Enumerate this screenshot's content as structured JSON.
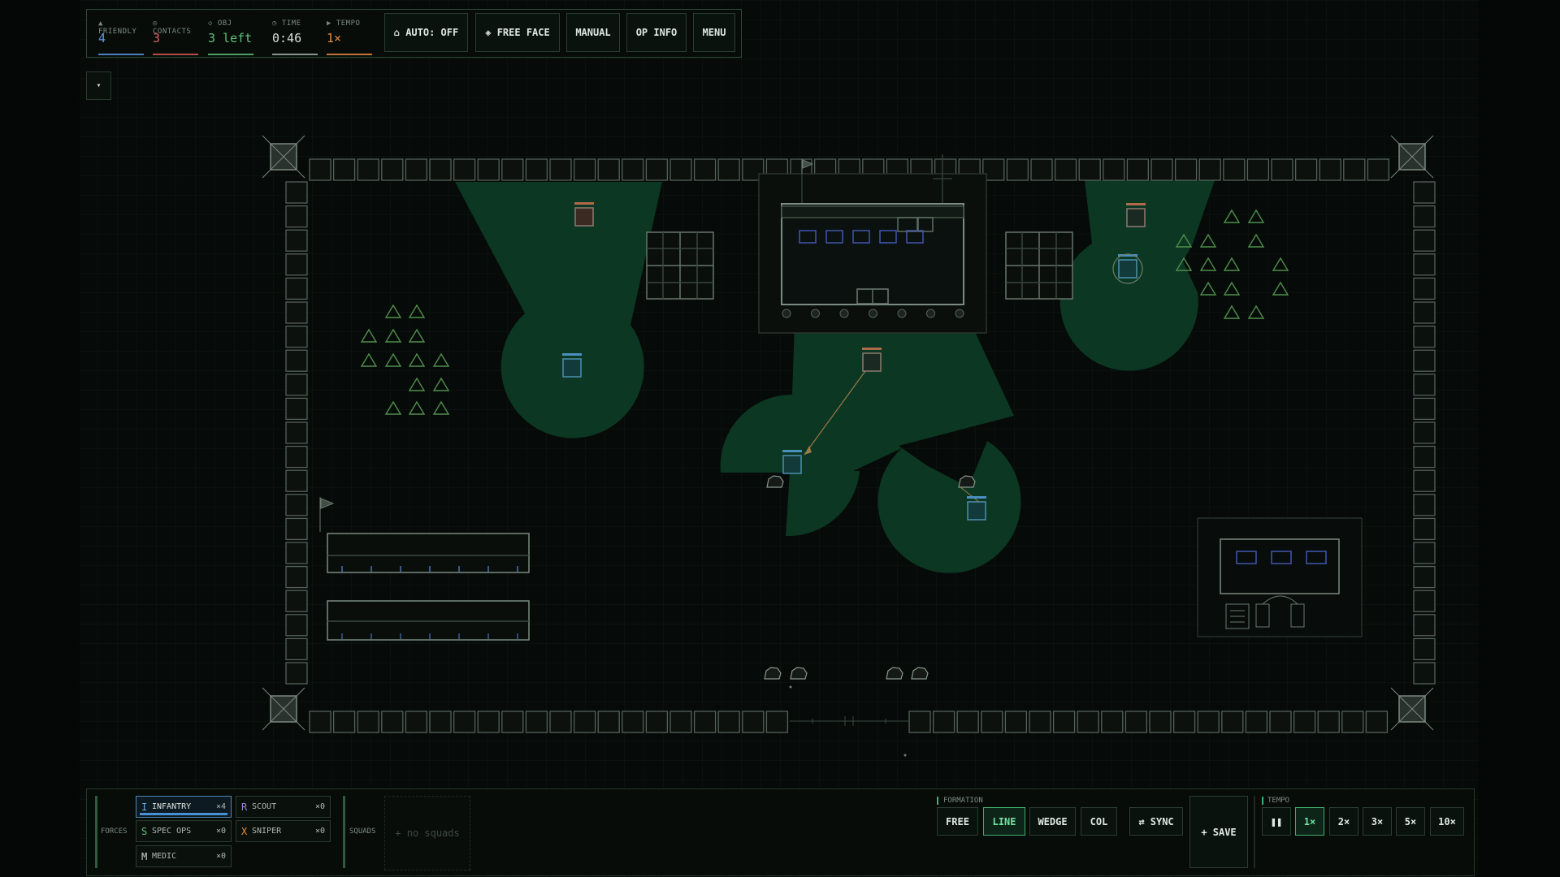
{
  "hud": {
    "stats": [
      {
        "label": "▲ FRIENDLY",
        "value": "4",
        "color": "#5a9be0"
      },
      {
        "label": "◎ CONTACTS",
        "value": "3",
        "color": "#d9605a"
      },
      {
        "label": "◇ OBJ",
        "value": "3 left",
        "color": "#5fc07d"
      },
      {
        "label": "◷ TIME",
        "value": "0:46",
        "color": "#d7dedb"
      },
      {
        "label": "▶ TEMPO",
        "value": "1×",
        "color": "#e38a3f"
      }
    ],
    "buttons": {
      "auto": "⌂ AUTO: OFF",
      "free_face": "◈ FREE FACE",
      "manual": "MANUAL",
      "op_info": "OP INFO",
      "menu": "MENU"
    }
  },
  "collapse_label": "▾",
  "bottom": {
    "forces_label": "FORCES",
    "units": [
      {
        "key": "I",
        "name": "INFANTRY",
        "count": "×4",
        "key_color": "#6aa6e6",
        "selected": true
      },
      {
        "key": "R",
        "name": "SCOUT",
        "count": "×0",
        "key_color": "#a07ee0"
      },
      {
        "key": "S",
        "name": "SPEC OPS",
        "count": "×0",
        "key_color": "#5fc07d"
      },
      {
        "key": "X",
        "name": "SNIPER",
        "count": "×0",
        "key_color": "#e38a3f"
      },
      {
        "key": "M",
        "name": "MEDIC",
        "count": "×0",
        "key_color": "#cfd6d2"
      }
    ],
    "squads_label": "SQUADS",
    "no_squads": "+ no squads",
    "formation_label": "FORMATION",
    "formations": [
      "FREE",
      "LINE",
      "WEDGE",
      "COL"
    ],
    "formation_active": "LINE",
    "sync": "⇄ SYNC",
    "save": "+ SAVE",
    "tempo_label": "TEMPO",
    "tempos": [
      "❚❚",
      "1×",
      "2×",
      "3×",
      "5×",
      "10×"
    ],
    "tempo_active": "1×"
  },
  "map": {
    "friendly_color": "#4a8fc0",
    "enemy_color": "#b06a4a",
    "vision_color": "#0d3a24",
    "tree_color": "#4f8f4a"
  }
}
